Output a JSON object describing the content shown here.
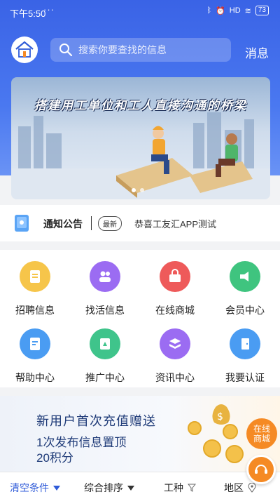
{
  "status": {
    "time": "下午5:50",
    "dots": "···",
    "signal": "HD",
    "battery": "73"
  },
  "header": {
    "search_placeholder": "搜索你要查找的信息",
    "message_label": "消息"
  },
  "banner": {
    "tagline": "搭建用工单位和工人直接沟通的桥梁"
  },
  "notice": {
    "title": "通知公告",
    "badge": "最新",
    "text": "恭喜工友汇APP测试"
  },
  "grid": {
    "items": [
      {
        "label": "招聘信息",
        "icon": "document-icon",
        "color": "#f6c54a"
      },
      {
        "label": "找活信息",
        "icon": "people-icon",
        "color": "#9b6cf2"
      },
      {
        "label": "在线商城",
        "icon": "shop-icon",
        "color": "#ee5a5a"
      },
      {
        "label": "会员中心",
        "icon": "megaphone-icon",
        "color": "#3fc47f"
      },
      {
        "label": "帮助中心",
        "icon": "help-doc-icon",
        "color": "#4a9cf2"
      },
      {
        "label": "推广中心",
        "icon": "promo-icon",
        "color": "#3fc48b"
      },
      {
        "label": "资讯中心",
        "icon": "news-icon",
        "color": "#9b6cf2"
      },
      {
        "label": "我要认证",
        "icon": "door-icon",
        "color": "#4a9cf2"
      }
    ]
  },
  "promo": {
    "line1": "新用户首次充值赠送",
    "line2": "1次发布信息置顶",
    "line3": "20积分",
    "mall_line1": "在线",
    "mall_line2": "商城"
  },
  "filter": {
    "clear": "清空条件",
    "sort": "综合排序",
    "trade": "工种",
    "region": "地区"
  },
  "colors": {
    "primary": "#3a63e6",
    "accent": "#2f5bd8",
    "orange": "#f58a24"
  }
}
